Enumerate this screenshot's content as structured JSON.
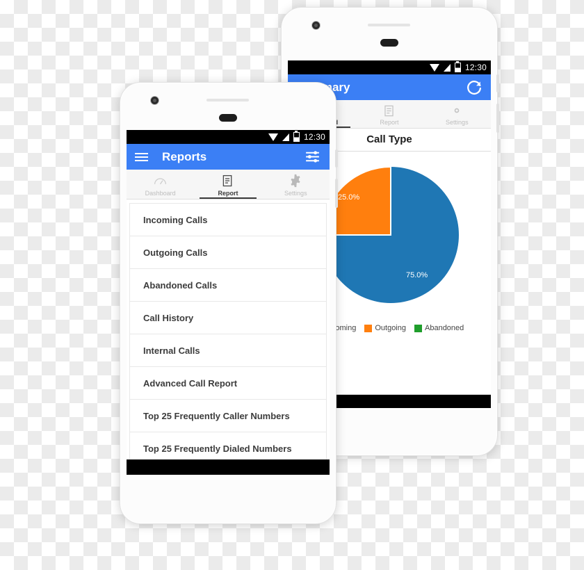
{
  "back_phone": {
    "status_bar": {
      "time": "12:30",
      "icons": [
        "wifi-icon",
        "signal-icon",
        "battery-icon"
      ]
    },
    "app_bar": {
      "title": "Summary",
      "action_icon": "refresh-icon"
    },
    "tabs": [
      {
        "label": "Dashboard",
        "icon": "gauge-icon",
        "active": true
      },
      {
        "label": "Report",
        "icon": "document-icon",
        "active": false
      },
      {
        "label": "Settings",
        "icon": "gear-icon",
        "active": false
      }
    ],
    "chart_heading": "Call Type",
    "colors": {
      "accent": "#3b7ff5",
      "incoming": "#1f77b4",
      "outgoing": "#ff7f0e",
      "abandoned": "#1f9e2c"
    }
  },
  "front_phone": {
    "status_bar": {
      "time": "12:30",
      "icons": [
        "wifi-icon",
        "signal-icon",
        "battery-icon"
      ]
    },
    "app_bar": {
      "title": "Reports",
      "menu_icon": "hamburger-icon",
      "action_icon": "filter-sliders-icon"
    },
    "tabs": [
      {
        "label": "Dashboard",
        "icon": "gauge-icon",
        "active": false
      },
      {
        "label": "Report",
        "icon": "document-icon",
        "active": true
      },
      {
        "label": "Settings",
        "icon": "gear-icon",
        "active": false
      }
    ],
    "report_list": [
      "Incoming Calls",
      "Outgoing Calls",
      "Abandoned Calls",
      "Call History",
      "Internal Calls",
      "Advanced Call Report",
      "Top 25 Frequently Caller Numbers",
      "Top 25 Frequently Dialed Numbers"
    ],
    "colors": {
      "accent": "#3b7ff5"
    }
  },
  "chart_data": {
    "type": "pie",
    "title": "Call Type",
    "categories": [
      "Incoming",
      "Outgoing",
      "Abandoned"
    ],
    "values": [
      75.0,
      25.0,
      0.0
    ],
    "value_labels": [
      "75.0%",
      "25.0%",
      ""
    ],
    "colors": [
      "#1f77b4",
      "#ff7f0e",
      "#1f9e2c"
    ],
    "legend": [
      "Incoming",
      "Outgoing",
      "Abandoned"
    ],
    "legend_position": "bottom",
    "units": "percent"
  }
}
